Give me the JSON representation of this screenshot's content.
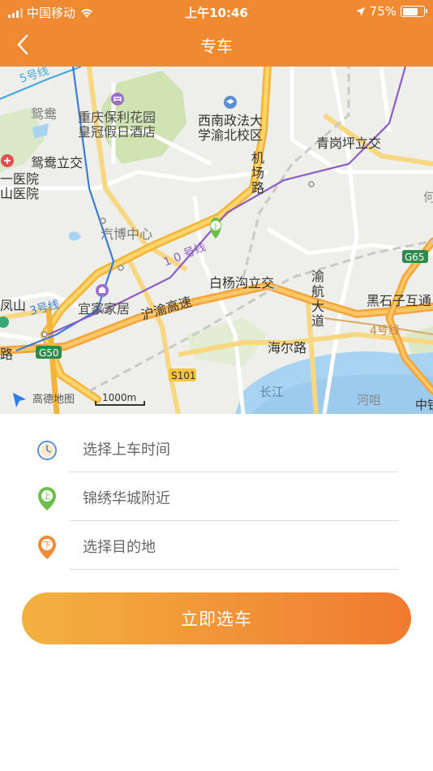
{
  "status_bar": {
    "carrier": "中国移动",
    "time": "上午10:46",
    "battery_percent": "75%",
    "battery_level": 0.75
  },
  "nav": {
    "title": "专车",
    "back_icon": "chevron-left-icon"
  },
  "map": {
    "labels": {
      "yuanyang": "鸳鸯",
      "yuanyang_interchange": "鸳鸯立交",
      "hotel_line1": "重庆保利花园",
      "hotel_line2": "皇冠假日酒店",
      "university_line1": "西南政法大",
      "university_line2": "学渝北校区",
      "qinggangping": "青岗坪立交",
      "hospital_line1": "一医院",
      "hospital_line2": "山医院",
      "airport_rd": "机场路",
      "auto_expo": "汽博中心",
      "line10": "1 0 号线",
      "baiyanggou": "白杨沟立交",
      "yuhang_ave": "渝航大道",
      "heishizi": "黑石子互通",
      "yijia": "宜家家居",
      "line3": "3号线",
      "line4": "4号线",
      "line5": "5号线",
      "hu_yu": "沪渝高速",
      "haier_rd": "海尔路",
      "fengshan": "凤山",
      "road_lu": "路",
      "g50": "G50",
      "g65": "G65",
      "s101": "S101",
      "changjiang": "长江",
      "hezui": "河咀",
      "zhongtie": "中铁",
      "he": "何",
      "amap_logo": "高德地图",
      "scale": "1000m"
    }
  },
  "form": {
    "time_row": {
      "label": "选择上车时间",
      "icon": "clock-icon"
    },
    "pickup_row": {
      "label": "锦绣华城附近",
      "icon": "pickup-pin-icon",
      "pin_text": "上"
    },
    "dest_row": {
      "label": "选择目的地",
      "icon": "destination-pin-icon",
      "pin_text": "下"
    },
    "submit_label": "立即选车"
  },
  "colors": {
    "brand_orange": "#f08a32",
    "gradient_start": "#f3b13f",
    "gradient_end": "#ef7a30",
    "pickup_green": "#6cbf4a",
    "dest_orange": "#ef8d3a",
    "clock_blue": "#5a8fd6"
  }
}
